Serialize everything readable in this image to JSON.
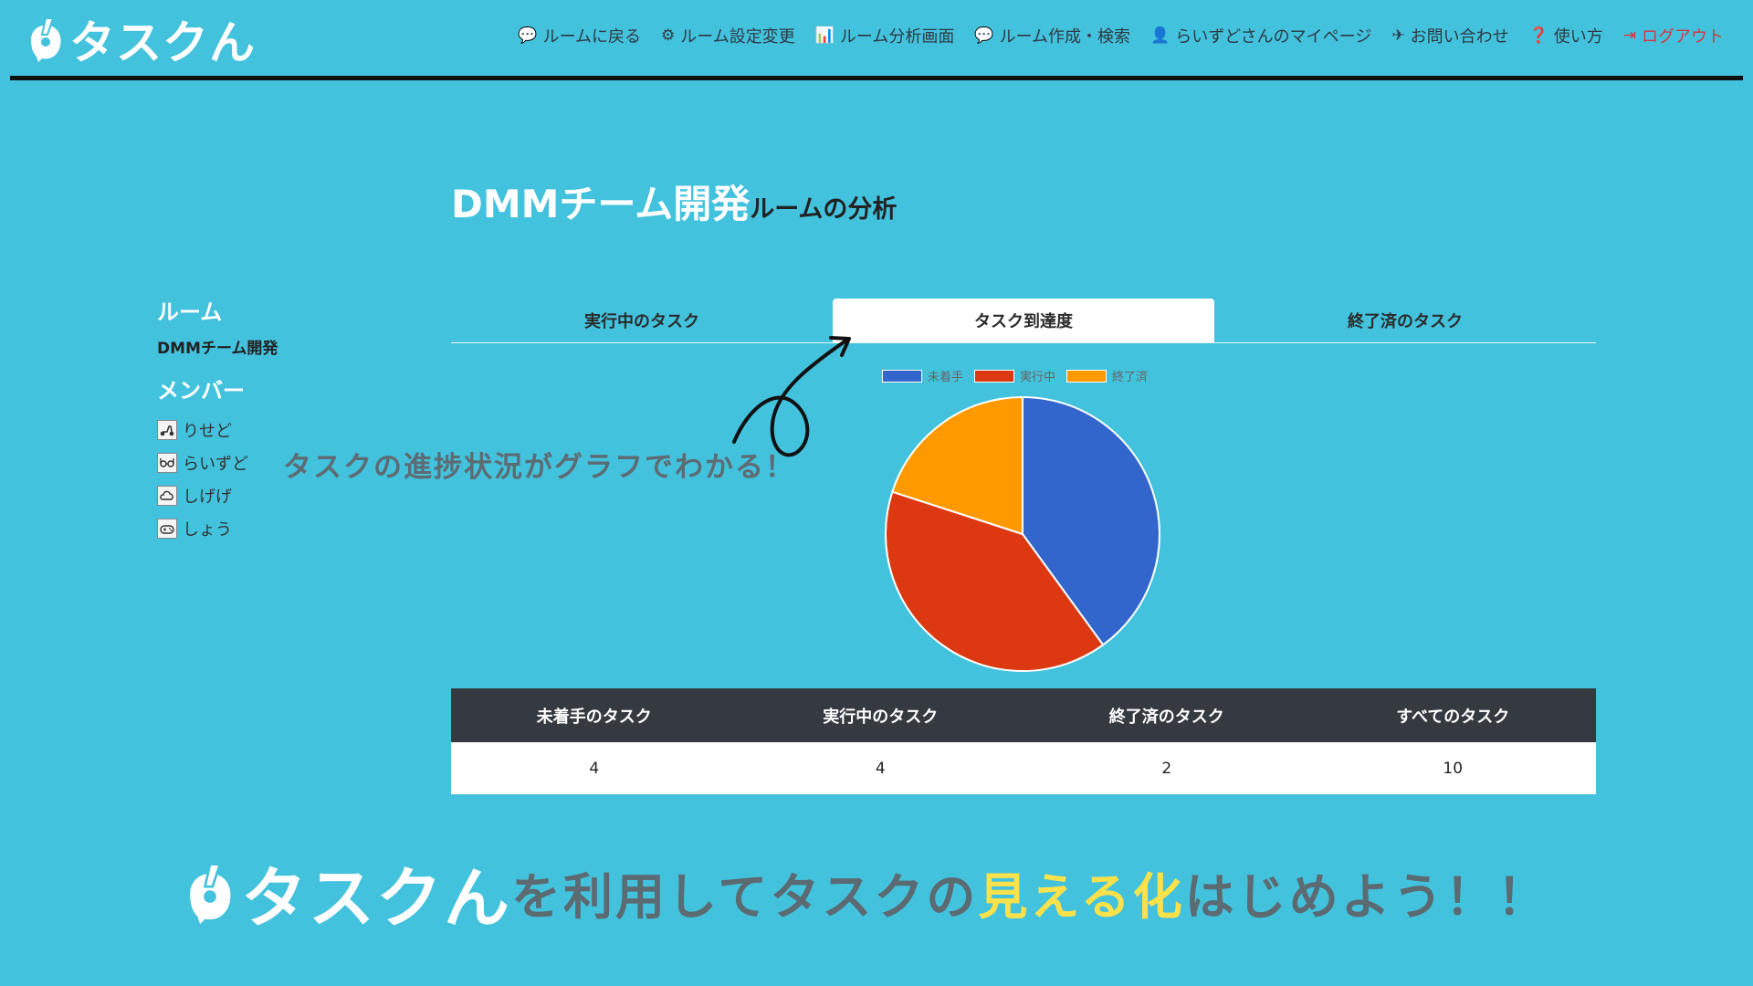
{
  "app": {
    "logo_text": "タスクん"
  },
  "nav": [
    {
      "icon": "chat-icon",
      "label": "ルームに戻る"
    },
    {
      "icon": "gears-icon",
      "label": "ルーム設定変更"
    },
    {
      "icon": "bar-chart-icon",
      "label": "ルーム分析画面"
    },
    {
      "icon": "chat-plus-icon",
      "label": "ルーム作成・検索"
    },
    {
      "icon": "user-gear-icon",
      "label": "らいずどさんのマイページ"
    },
    {
      "icon": "paper-plane-icon",
      "label": "お問い合わせ"
    },
    {
      "icon": "question-circle-icon",
      "label": "使い方"
    },
    {
      "icon": "logout-icon",
      "label": "ログアウト"
    }
  ],
  "page": {
    "room_name": "DMMチーム開発",
    "title_suffix": "ルームの分析"
  },
  "sidebar": {
    "room_heading": "ルーム",
    "room_name": "DMMチーム開発",
    "members_heading": "メンバー",
    "members": [
      "りせど",
      "らいずど",
      "しげげ",
      "しょう"
    ]
  },
  "tabs": [
    {
      "label": "実行中のタスク",
      "active": false
    },
    {
      "label": "タスク到達度",
      "active": true
    },
    {
      "label": "終了済のタスク",
      "active": false
    }
  ],
  "annotation": "タスクの進捗状況がグラフでわかる！",
  "chart_data": {
    "type": "pie",
    "categories": [
      "未着手",
      "実行中",
      "終了済"
    ],
    "values": [
      4,
      4,
      2
    ],
    "colors": [
      "#3366cc",
      "#dc3912",
      "#ff9900"
    ],
    "legend_position": "top"
  },
  "table": {
    "headers": [
      "未着手のタスク",
      "実行中のタスク",
      "終了済のタスク",
      "すべてのタスク"
    ],
    "values": [
      "4",
      "4",
      "2",
      "10"
    ]
  },
  "banner": {
    "logo": "タスクん",
    "part1": "を利用してタスクの",
    "highlight": "見える化",
    "part2": "はじめよう！！"
  }
}
